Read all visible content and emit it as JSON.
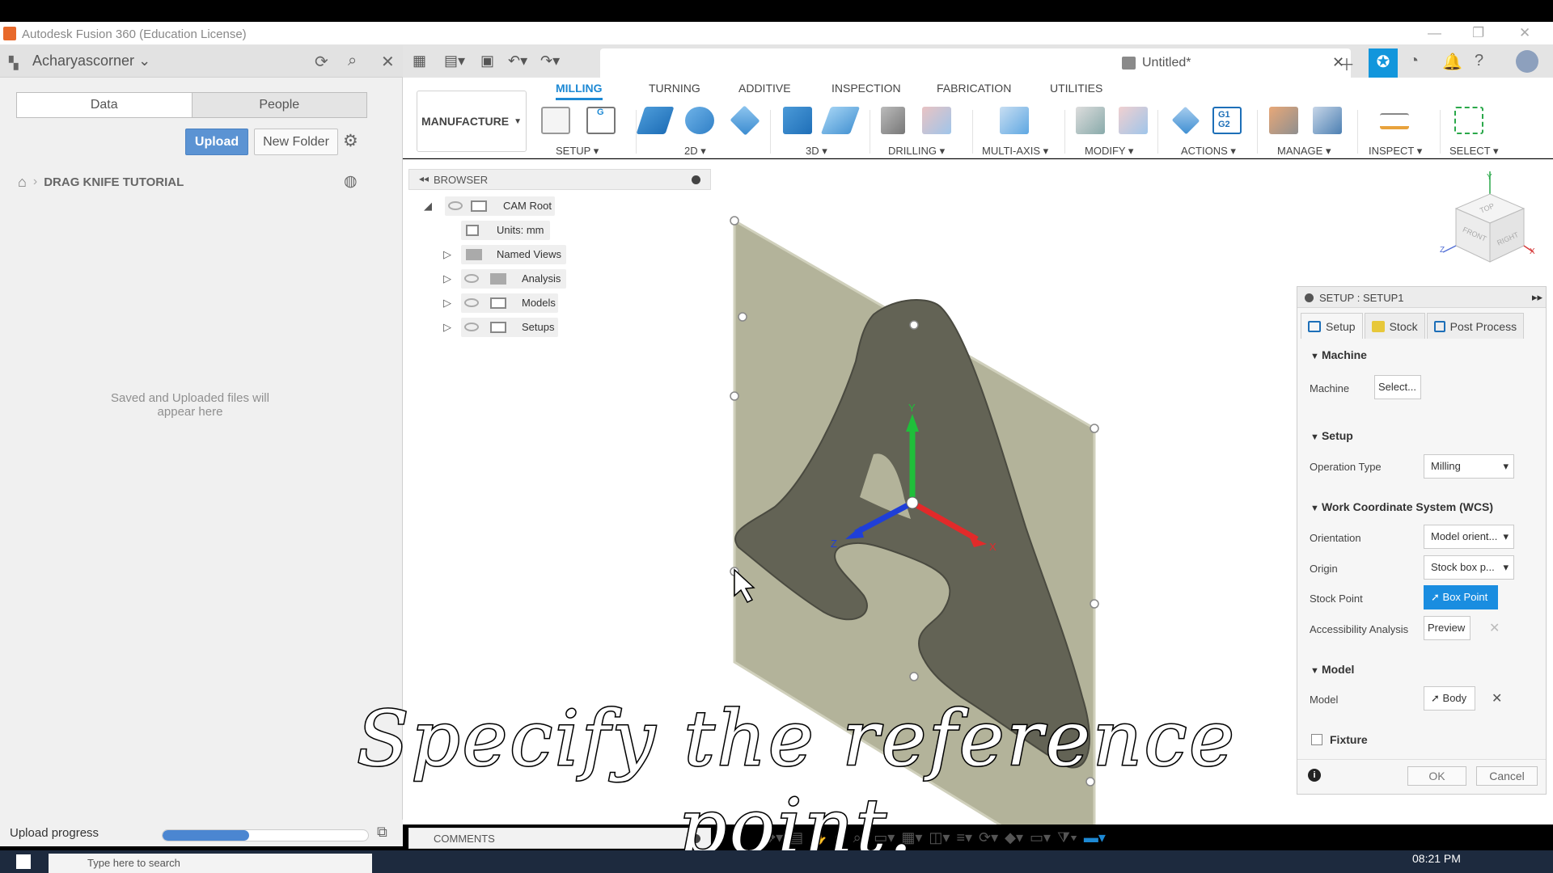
{
  "window": {
    "title": "Autodesk Fusion 360 (Education License)"
  },
  "data_panel": {
    "user": "Acharyascorner",
    "tabs": [
      "Data",
      "People"
    ],
    "upload_label": "Upload",
    "new_folder_label": "New Folder",
    "breadcrumb": "DRAG KNIFE TUTORIAL",
    "empty_message": "Saved and Uploaded files will appear here",
    "upload_progress_label": "Upload progress",
    "upload_progress_fraction": 0.42
  },
  "document": {
    "name": "Untitled*"
  },
  "ribbon": {
    "workspace": "MANUFACTURE",
    "tabs": [
      "MILLING",
      "TURNING",
      "ADDITIVE",
      "INSPECTION",
      "FABRICATION",
      "UTILITIES"
    ],
    "active_tab": "MILLING",
    "groups": [
      "SETUP ▾",
      "2D ▾",
      "3D ▾",
      "DRILLING ▾",
      "MULTI-AXIS ▾",
      "MODIFY ▾",
      "ACTIONS ▾",
      "MANAGE ▾",
      "INSPECT ▾",
      "SELECT ▾"
    ]
  },
  "browser": {
    "title": "BROWSER",
    "items": [
      {
        "label": "CAM Root"
      },
      {
        "label": "Units: mm"
      },
      {
        "label": "Named Views"
      },
      {
        "label": "Analysis"
      },
      {
        "label": "Models"
      },
      {
        "label": "Setups"
      }
    ]
  },
  "comments": {
    "title": "COMMENTS"
  },
  "viewcube": {
    "top": "TOP",
    "front": "FRONT",
    "right": "RIGHT",
    "x": "X",
    "y": "Y",
    "z": "Z"
  },
  "triad": {
    "x": "X",
    "y": "Y",
    "z": "Z"
  },
  "setup_panel": {
    "title": "SETUP : SETUP1",
    "tabs": [
      "Setup",
      "Stock",
      "Post Process"
    ],
    "machine_section": "Machine",
    "machine_label": "Machine",
    "machine_value": "Select...",
    "setup_section": "Setup",
    "operation_type_label": "Operation Type",
    "operation_type_value": "Milling",
    "wcs_section": "Work Coordinate System (WCS)",
    "orientation_label": "Orientation",
    "orientation_value": "Model orient...",
    "origin_label": "Origin",
    "origin_value": "Stock box p...",
    "stock_point_label": "Stock Point",
    "stock_point_value": "Box Point",
    "accessibility_label": "Accessibility Analysis",
    "accessibility_value": "Preview",
    "model_section": "Model",
    "model_label": "Model",
    "model_value": "Body",
    "fixture_label": "Fixture",
    "ok_label": "OK",
    "cancel_label": "Cancel"
  },
  "caption": "Specify the reference point.",
  "taskbar": {
    "search_placeholder": "Type here to search",
    "time": "08:21 PM"
  },
  "colors": {
    "accent": "#1d89d4",
    "upload": "#5b93d3",
    "plate": "#b3b39a",
    "letter": "#636355"
  }
}
